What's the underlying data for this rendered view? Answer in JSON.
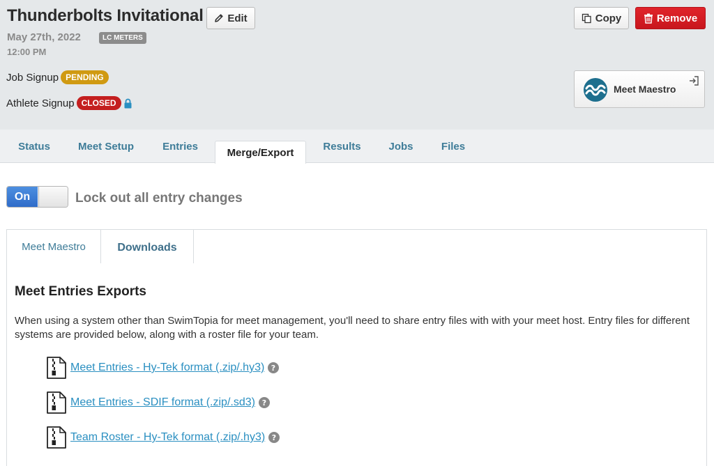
{
  "meet": {
    "title": "Thunderbolts Invitational",
    "date": "May 27th, 2022",
    "course": "LC METERS",
    "time": "12:00 PM"
  },
  "actions": {
    "edit_label": "Edit",
    "copy_label": "Copy",
    "remove_label": "Remove"
  },
  "signup": {
    "job_label": "Job Signup",
    "job_status": "PENDING",
    "athlete_label": "Athlete Signup",
    "athlete_status": "CLOSED"
  },
  "meet_maestro_button": {
    "label": "Meet Maestro"
  },
  "tabs": [
    {
      "label": "Status"
    },
    {
      "label": "Meet Setup"
    },
    {
      "label": "Entries"
    },
    {
      "label": "Merge/Export"
    },
    {
      "label": "Results"
    },
    {
      "label": "Jobs"
    },
    {
      "label": "Files"
    }
  ],
  "active_tab": "Merge/Export",
  "lock_toggle": {
    "state_label": "On",
    "label": "Lock out all entry changes"
  },
  "subtabs": [
    {
      "label": "Meet Maestro"
    },
    {
      "label": "Downloads"
    }
  ],
  "active_subtab": "Downloads",
  "exports": {
    "title": "Meet Entries Exports",
    "description": "When using a system other than SwimTopia for meet management, you'll need to share entry files with with your meet host. Entry files for different systems are provided below, along with a roster file for your team.",
    "files": [
      {
        "label": "Meet Entries - Hy-Tek format (.zip/.hy3)"
      },
      {
        "label": "Meet Entries - SDIF format (.zip/.sd3)"
      },
      {
        "label": "Team Roster - Hy-Tek format (.zip/.hy3)"
      }
    ]
  },
  "colors": {
    "header_bg": "#e5e8ea",
    "tab_text": "#3e7c98",
    "remove_red": "#d21c24",
    "pending": "#d09a12",
    "closed": "#c41f1f",
    "toggle_blue": "#3b7bd6",
    "link": "#2a8fc1"
  },
  "icons": {
    "edit": "pencil-icon",
    "copy": "copy-icon",
    "remove": "trash-icon",
    "lock": "lock-icon",
    "meet_maestro": "waves-logo-icon",
    "open": "open-external-icon",
    "file": "zip-file-icon",
    "help": "help-icon"
  }
}
